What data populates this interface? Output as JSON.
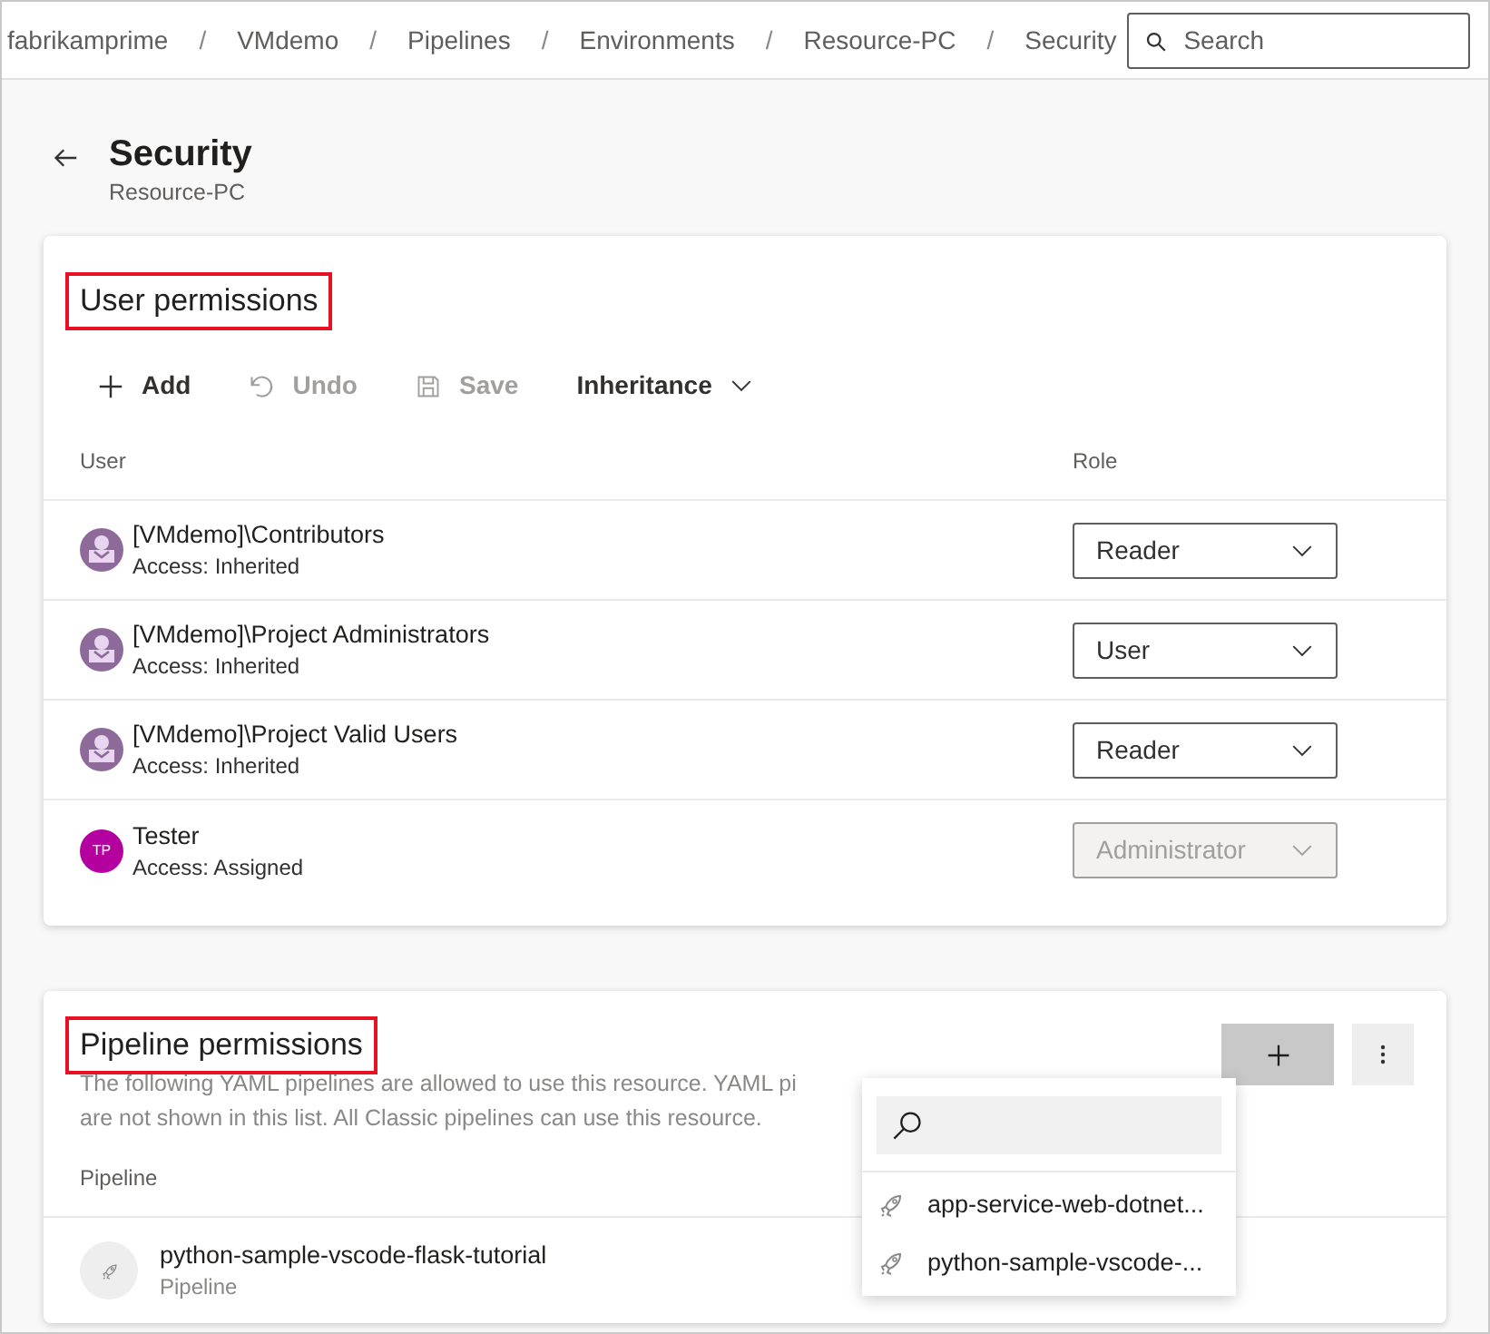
{
  "breadcrumbs": [
    "fabrikamprime",
    "VMdemo",
    "Pipelines",
    "Environments",
    "Resource-PC",
    "Security"
  ],
  "breadcrumb_separator": "/",
  "search": {
    "placeholder": "Search"
  },
  "page": {
    "title": "Security",
    "subtitle": "Resource-PC"
  },
  "user_permissions": {
    "title": "User permissions",
    "highlighted": true,
    "toolbar": [
      {
        "kind": "add",
        "label": "Add",
        "disabled": false
      },
      {
        "kind": "undo",
        "label": "Undo",
        "disabled": true
      },
      {
        "kind": "save",
        "label": "Save",
        "disabled": true
      },
      {
        "kind": "dropdown",
        "label": "Inheritance",
        "disabled": false
      }
    ],
    "columns": [
      "User",
      "Role"
    ],
    "rows": [
      {
        "name": "[VMdemo]\\Contributors",
        "access": "Access: Inherited",
        "kind": "group",
        "role": "Reader",
        "disabled": false
      },
      {
        "name": "[VMdemo]\\Project Administrators",
        "access": "Access: Inherited",
        "kind": "group",
        "role": "User",
        "disabled": false
      },
      {
        "name": "[VMdemo]\\Project Valid Users",
        "access": "Access: Inherited",
        "kind": "group",
        "role": "Reader",
        "disabled": false
      },
      {
        "name": "Tester",
        "access": "Access: Assigned",
        "kind": "initials",
        "initials": "TP",
        "role": "Administrator",
        "disabled": true
      }
    ]
  },
  "pipeline_permissions": {
    "title": "Pipeline permissions",
    "highlighted": true,
    "description": [
      "The following YAML pipelines are allowed to use this resource. YAML pi",
      "are not shown in this list. All Classic pipelines can use this resource."
    ],
    "columns": [
      "Pipeline"
    ],
    "rows": [
      {
        "name": "python-sample-vscode-flask-tutorial",
        "type": "Pipeline"
      }
    ],
    "popup": {
      "items": [
        "app-service-web-dotnet...",
        "python-sample-vscode-..."
      ]
    }
  }
}
